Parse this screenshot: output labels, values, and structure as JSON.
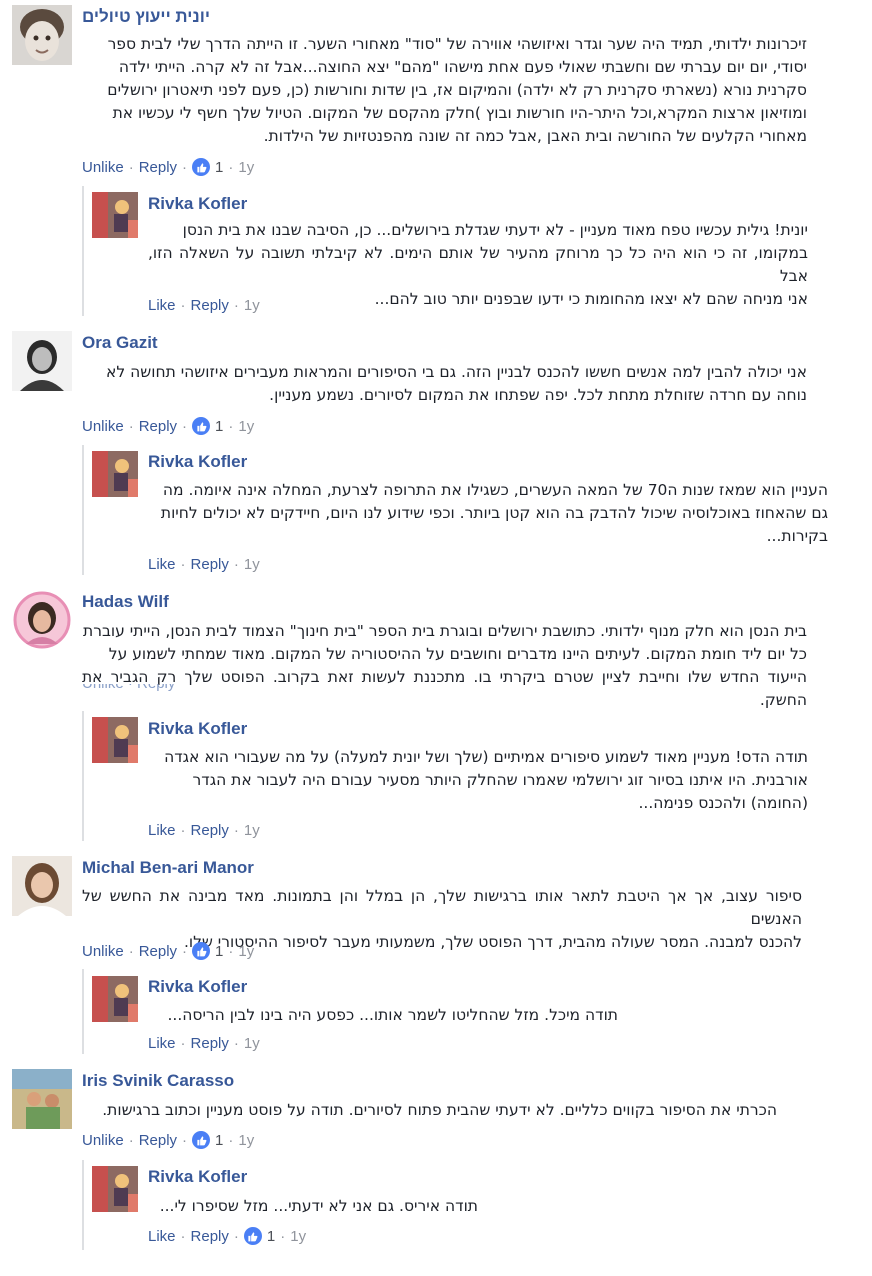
{
  "labels": {
    "unlike": "Unlike",
    "like": "Like",
    "reply": "Reply",
    "dot": "·"
  },
  "comments": [
    {
      "name": "יונית ייעוץ טיולים",
      "lines": [
        "זיכרונות ילדותי, תמיד היה שער וגדר ואיזושהי אווירה של \"סוד\" מאחורי השער. זו הייתה הדרך שלי לבית ספר",
        "יסודי, יום יום עברתי שם וחשבתי שאולי פעם אחת מישהו \"מהם\" יצא החוצה...אבל זה לא קרה. הייתי ילדה",
        "סקרנית נורא (נשארתי סקרנית רק לא ילדה) והמיקום אז, בין שדות וחורשות (כן, פעם לפני תיאטרון ירושלים",
        "ומוזיאון ארצות המקרא,וכל היתר-היו חורשות ובוץ )חלק מהקסם של המקום. הטיול שלך חשף לי עכשיו את",
        "מאחורי הקלעים של החורשה ובית האבן ,אבל כמה זה שונה מהפנטזיות של הילדות."
      ],
      "likes": "1",
      "time": "1y",
      "reply": {
        "name": "Rivka Kofler",
        "lines": [
          "יונית! גילית עכשיו טפח מאוד מעניין - לא ידעתי שגדלת בירושלים... כן, הסיבה שבנו את בית הנסן",
          "במקומו, זה כי הוא היה כל כך מרוחק מהעיר של אותם הימים. לא קיבלתי תשובה על השאלה הזו, אבל",
          "אני מניחה שהם לא יצאו מהחומות כי ידעו שבפנים יותר טוב להם..."
        ],
        "time": "1y"
      }
    },
    {
      "name": "Ora Gazit",
      "lines": [
        "אני יכולה להבין למה אנשים חששו להכנס לבניין הזה. גם בי הסיפורים והמראות מעבירים איזושהי תחושה לא",
        "נוחה עם חרדה שזוחלת מתחת לכל. יפה שפתחו את המקום לסיורים. נשמע מעניין."
      ],
      "likes": "1",
      "time": "1y",
      "reply": {
        "name": "Rivka Kofler",
        "lines": [
          "העניין הוא שמאז שנות ה70 של המאה העשרים, כשגילו את התרופה לצרעת, המחלה אינה איומה. מה",
          "גם שהאחוז באוכלוסיה שיכול להדבק בה הוא קטן ביותר. וכפי שידוע לנו היום, חיידקים לא יכולים לחיות",
          "בקירות..."
        ],
        "time": "1y"
      }
    },
    {
      "name": "Hadas Wilf",
      "lines": [
        "בית הנסן הוא חלק מנוף ילדותי. כתושבת ירושלים ובוגרת בית הספר \"בית חינוך\" הצמוד לבית הנסן, הייתי עוברת",
        "כל יום ליד חומת המקום. לעיתים היינו מדברים וחושבים על ההיסטוריה של המקום. מאוד שמחתי לשמוע על",
        "הייעוד החדש שלו וחייבת לציין שטרם ביקרתי בו. מתכננת לעשות זאת בקרוב. הפוסט שלך רק הגביר את החשק."
      ],
      "likes": "",
      "time": "",
      "reply": {
        "name": "Rivka Kofler",
        "lines": [
          "תודה הדס! מעניין מאוד לשמוע סיפורים אמיתיים (שלך ושל יונית למעלה) על מה שעבורי הוא אגדה",
          "אורבנית. היו איתנו בסיור זוג ירושלמי שאמרו שהחלק היותר מסעיר עבורם היה לעבור את הגדר",
          "(החומה) ולהכנס פנימה..."
        ],
        "time": "1y"
      }
    },
    {
      "name": "Michal Ben-ari Manor",
      "lines": [
        "סיפור עצוב, אך אך היטבת לתאר אותו ברגישות שלך, הן במלל והן בתמונות. מאד מבינה את החשש של האנשים",
        "להכנס למבנה. המסר שעולה מהבית, דרך הפוסט שלך, משמעותי מעבר לסיפור ההיסטורי שלו."
      ],
      "likes": "1",
      "time": "1y",
      "reply": {
        "name": "Rivka Kofler",
        "lines": [
          "תודה מיכל. מזל שהחליטו לשמר אותו... כפסע היה בינו לבין הריסה..."
        ],
        "time": "1y"
      }
    },
    {
      "name": "Iris Svinik Carasso",
      "lines": [
        "הכרתי את הסיפור בקווים כלליים. לא ידעתי שהבית פתוח לסיורים. תודה על פוסט מעניין וכתוב ברגישות."
      ],
      "likes": "1",
      "time": "1y",
      "reply": {
        "name": "Rivka Kofler",
        "lines": [
          "תודה איריס. גם אני לא ידעתי... מזל שסיפרו לי..."
        ],
        "likes": "1",
        "time": "1y"
      }
    }
  ],
  "colors": {
    "link": "#385898",
    "meta": "#90949c",
    "like_badge": "#4a7ff5",
    "line": "#dddfe2"
  }
}
